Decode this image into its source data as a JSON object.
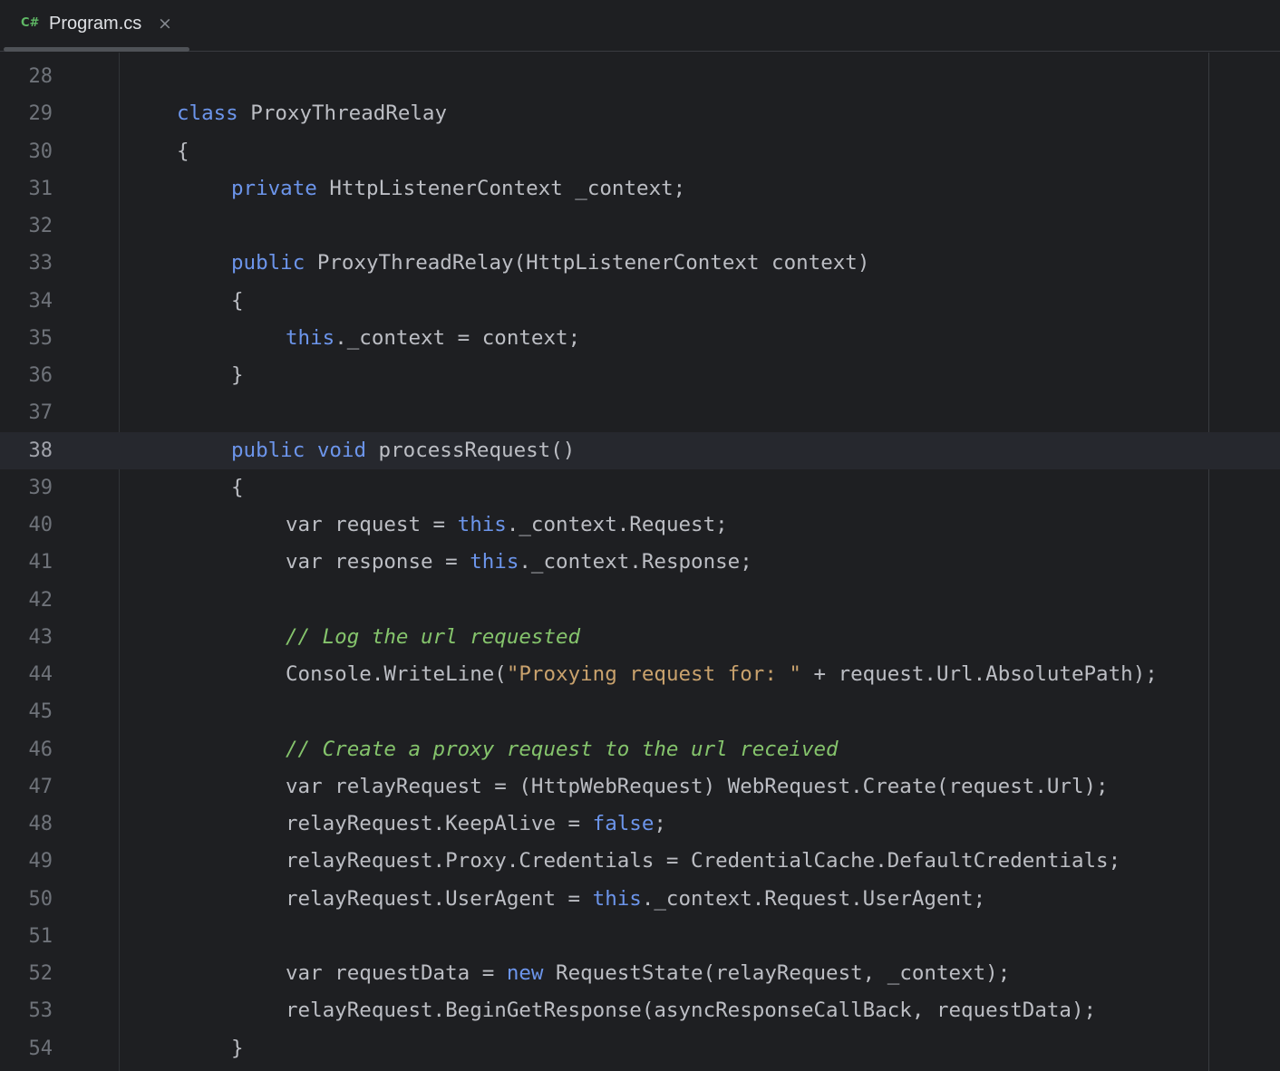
{
  "tab": {
    "lang_icon": "C#",
    "title": "Program.cs",
    "close_icon": "×",
    "close_icon_name": "close-icon"
  },
  "editor": {
    "current_line": 38,
    "lines": [
      {
        "num": "28",
        "indent": 0,
        "tokens": []
      },
      {
        "num": "29",
        "indent": 0,
        "tokens": [
          {
            "t": "class",
            "k": "kw"
          },
          {
            "t": " ProxyThreadRelay",
            "k": "plain"
          }
        ]
      },
      {
        "num": "30",
        "indent": 0,
        "tokens": [
          {
            "t": "{",
            "k": "plain"
          }
        ]
      },
      {
        "num": "31",
        "indent": 1,
        "tokens": [
          {
            "t": "private",
            "k": "kw"
          },
          {
            "t": " HttpListenerContext _context;",
            "k": "plain"
          }
        ]
      },
      {
        "num": "32",
        "indent": 0,
        "tokens": []
      },
      {
        "num": "33",
        "indent": 1,
        "tokens": [
          {
            "t": "public",
            "k": "kw"
          },
          {
            "t": " ProxyThreadRelay(HttpListenerContext context)",
            "k": "plain"
          }
        ]
      },
      {
        "num": "34",
        "indent": 1,
        "tokens": [
          {
            "t": "{",
            "k": "plain"
          }
        ]
      },
      {
        "num": "35",
        "indent": 2,
        "tokens": [
          {
            "t": "this",
            "k": "kw"
          },
          {
            "t": "._context = context;",
            "k": "plain"
          }
        ]
      },
      {
        "num": "36",
        "indent": 1,
        "tokens": [
          {
            "t": "}",
            "k": "plain"
          }
        ]
      },
      {
        "num": "37",
        "indent": 0,
        "tokens": []
      },
      {
        "num": "38",
        "indent": 1,
        "tokens": [
          {
            "t": "public",
            "k": "kw"
          },
          {
            "t": " ",
            "k": "plain"
          },
          {
            "t": "void",
            "k": "kw"
          },
          {
            "t": " processRequest()",
            "k": "plain"
          }
        ]
      },
      {
        "num": "39",
        "indent": 1,
        "tokens": [
          {
            "t": "{",
            "k": "plain"
          }
        ]
      },
      {
        "num": "40",
        "indent": 2,
        "tokens": [
          {
            "t": "var request = ",
            "k": "plain"
          },
          {
            "t": "this",
            "k": "kw"
          },
          {
            "t": "._context.Request;",
            "k": "plain"
          }
        ]
      },
      {
        "num": "41",
        "indent": 2,
        "tokens": [
          {
            "t": "var response = ",
            "k": "plain"
          },
          {
            "t": "this",
            "k": "kw"
          },
          {
            "t": "._context.Response;",
            "k": "plain"
          }
        ]
      },
      {
        "num": "42",
        "indent": 0,
        "tokens": []
      },
      {
        "num": "43",
        "indent": 2,
        "tokens": [
          {
            "t": "// Log the url requested",
            "k": "cm"
          }
        ]
      },
      {
        "num": "44",
        "indent": 2,
        "tokens": [
          {
            "t": "Console.WriteLine(",
            "k": "plain"
          },
          {
            "t": "\"Proxying request for: \"",
            "k": "str"
          },
          {
            "t": " + request.Url.AbsolutePath);",
            "k": "plain"
          }
        ]
      },
      {
        "num": "45",
        "indent": 0,
        "tokens": []
      },
      {
        "num": "46",
        "indent": 2,
        "tokens": [
          {
            "t": "// Create a proxy request to the url received",
            "k": "cm"
          }
        ]
      },
      {
        "num": "47",
        "indent": 2,
        "tokens": [
          {
            "t": "var relayRequest = (HttpWebRequest) WebRequest.Create(request.Url);",
            "k": "plain"
          }
        ]
      },
      {
        "num": "48",
        "indent": 2,
        "tokens": [
          {
            "t": "relayRequest.KeepAlive = ",
            "k": "plain"
          },
          {
            "t": "false",
            "k": "kw"
          },
          {
            "t": ";",
            "k": "plain"
          }
        ]
      },
      {
        "num": "49",
        "indent": 2,
        "tokens": [
          {
            "t": "relayRequest.Proxy.Credentials = CredentialCache.DefaultCredentials;",
            "k": "plain"
          }
        ]
      },
      {
        "num": "50",
        "indent": 2,
        "tokens": [
          {
            "t": "relayRequest.UserAgent = ",
            "k": "plain"
          },
          {
            "t": "this",
            "k": "kw"
          },
          {
            "t": "._context.Request.UserAgent;",
            "k": "plain"
          }
        ]
      },
      {
        "num": "51",
        "indent": 0,
        "tokens": []
      },
      {
        "num": "52",
        "indent": 2,
        "tokens": [
          {
            "t": "var requestData = ",
            "k": "plain"
          },
          {
            "t": "new",
            "k": "kw"
          },
          {
            "t": " RequestState(relayRequest, _context);",
            "k": "plain"
          }
        ]
      },
      {
        "num": "53",
        "indent": 2,
        "tokens": [
          {
            "t": "relayRequest.BeginGetResponse(asyncResponseCallBack, requestData);",
            "k": "plain"
          }
        ]
      },
      {
        "num": "54",
        "indent": 1,
        "tokens": [
          {
            "t": "}",
            "k": "plain"
          }
        ]
      }
    ]
  }
}
